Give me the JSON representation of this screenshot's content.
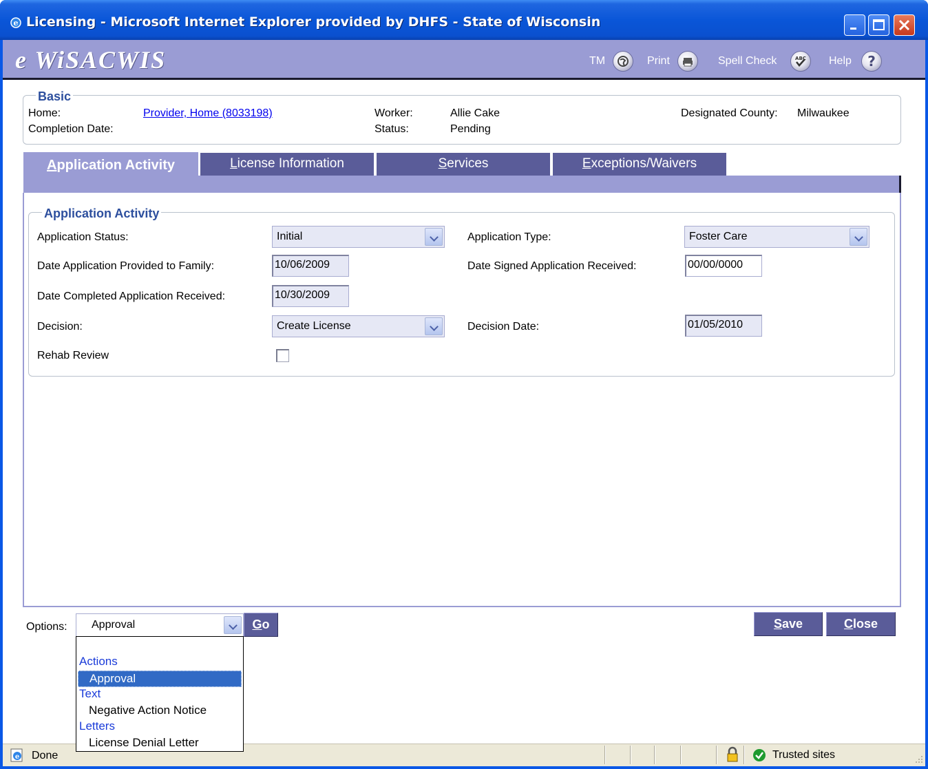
{
  "window": {
    "title": "Licensing - Microsoft Internet Explorer provided by DHFS - State of Wisconsin"
  },
  "app": {
    "logo": "e WiSACWIS",
    "toolbar": {
      "tm_label": "TM",
      "print_label": "Print",
      "spellcheck_label": "Spell Check",
      "help_label": "Help"
    }
  },
  "basic": {
    "legend": "Basic",
    "home_label": "Home:",
    "home_value": "Provider, Home (8033198)",
    "completion_label": "Completion Date:",
    "worker_label": "Worker:",
    "worker_value": "Allie Cake",
    "status_label": "Status:",
    "status_value": "Pending",
    "county_label": "Designated County:",
    "county_value": "Milwaukee"
  },
  "tabs": [
    {
      "label": "Application Activity",
      "accesskey": "A",
      "rest": "pplication Activity"
    },
    {
      "label": "License Information",
      "accesskey": "L",
      "rest": "icense Information"
    },
    {
      "label": "Services",
      "accesskey": "S",
      "rest": "ervices"
    },
    {
      "label": "Exceptions/Waivers",
      "accesskey": "E",
      "rest": "xceptions/Waivers"
    }
  ],
  "application_activity": {
    "legend": "Application Activity",
    "status_label": "Application Status:",
    "status_value": "Initial",
    "type_label": "Application Type:",
    "type_value": "Foster Care",
    "provided_label": "Date Application Provided to Family:",
    "provided_value": "10/06/2009",
    "signed_label": "Date Signed Application Received:",
    "signed_value": "00/00/0000",
    "completed_label": "Date Completed Application Received:",
    "completed_value": "10/30/2009",
    "decision_label": "Decision:",
    "decision_value": "Create License",
    "decision_date_label": "Decision Date:",
    "decision_date_value": "01/05/2010",
    "rehab_label": "Rehab Review",
    "rehab_checked": false
  },
  "options": {
    "label": "Options:",
    "selected": "Approval",
    "go_label": "Go",
    "go_accesskey": "G",
    "go_rest": "o",
    "list": {
      "group_actions": "Actions",
      "item_approval": "Approval",
      "group_text": "Text",
      "item_negative": "Negative Action Notice",
      "group_letters": "Letters",
      "item_denial": "License Denial Letter"
    }
  },
  "buttons": {
    "save_accesskey": "S",
    "save_rest": "ave",
    "close_accesskey": "C",
    "close_rest": "lose"
  },
  "statusbar": {
    "status_text": "Done",
    "zone_text": "Trusted sites"
  },
  "colors": {
    "header_bg": "#9a9cd4",
    "tab_bg": "#5a5c99",
    "legend_text": "#2d4f9e",
    "titlebar": "#0a56d8"
  }
}
